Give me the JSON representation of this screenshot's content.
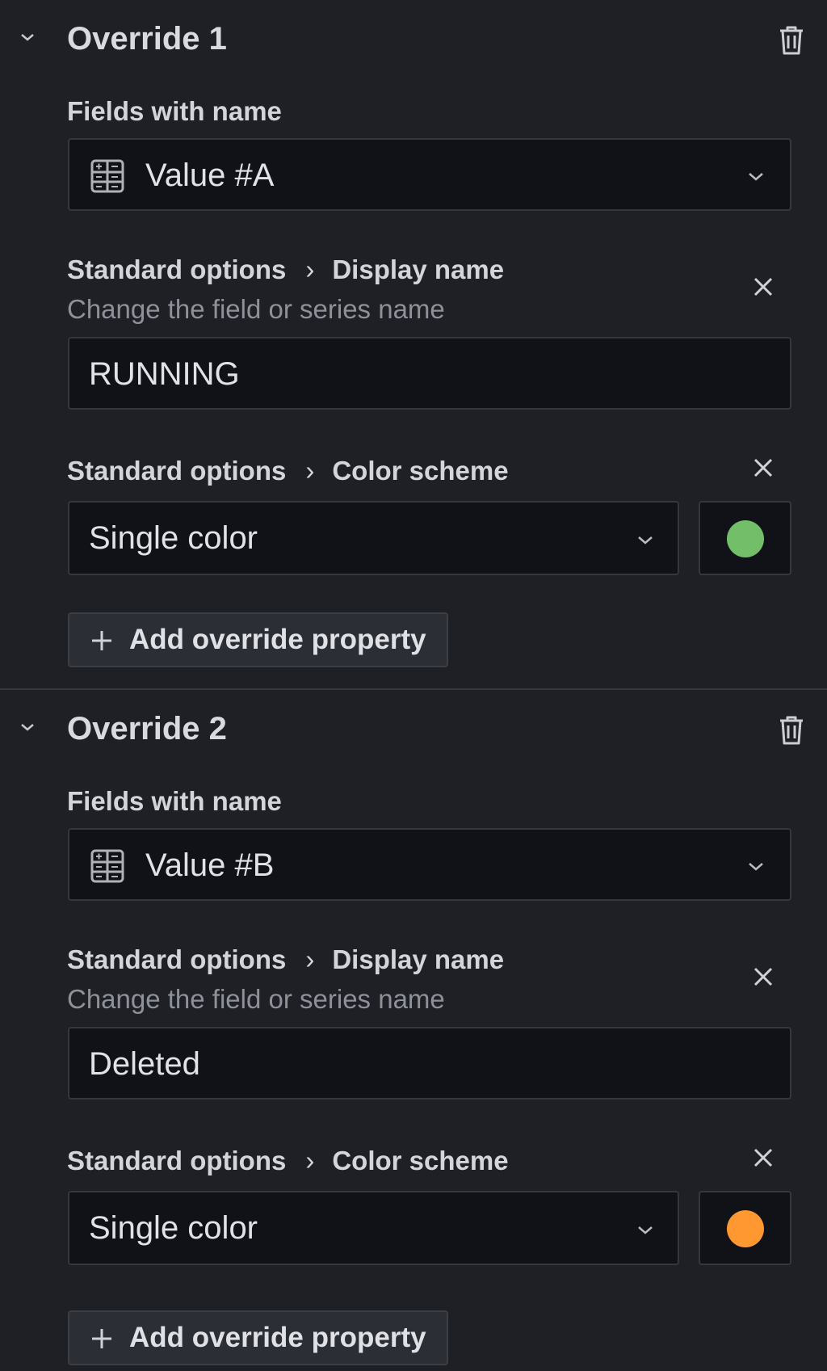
{
  "overrides": [
    {
      "title": "Override 1",
      "matcher_label": "Fields with name",
      "field_value": "Value #A",
      "display_name": {
        "category": "Standard options",
        "property": "Display name",
        "description": "Change the field or series name",
        "value": "RUNNING"
      },
      "color_scheme": {
        "category": "Standard options",
        "property": "Color scheme",
        "value": "Single color",
        "swatch_color": "#73bf69"
      },
      "add_label": "Add override property"
    },
    {
      "title": "Override 2",
      "matcher_label": "Fields with name",
      "field_value": "Value #B",
      "display_name": {
        "category": "Standard options",
        "property": "Display name",
        "description": "Change the field or series name",
        "value": "Deleted"
      },
      "color_scheme": {
        "category": "Standard options",
        "property": "Color scheme",
        "value": "Single color",
        "swatch_color": "#ff9830"
      },
      "add_label": "Add override property"
    }
  ],
  "icons": {
    "collapse": "chevron-down-icon",
    "delete": "trash-icon",
    "field": "field-table-icon",
    "dropdown": "chevron-down-icon",
    "remove": "close-icon",
    "add": "plus-icon"
  }
}
